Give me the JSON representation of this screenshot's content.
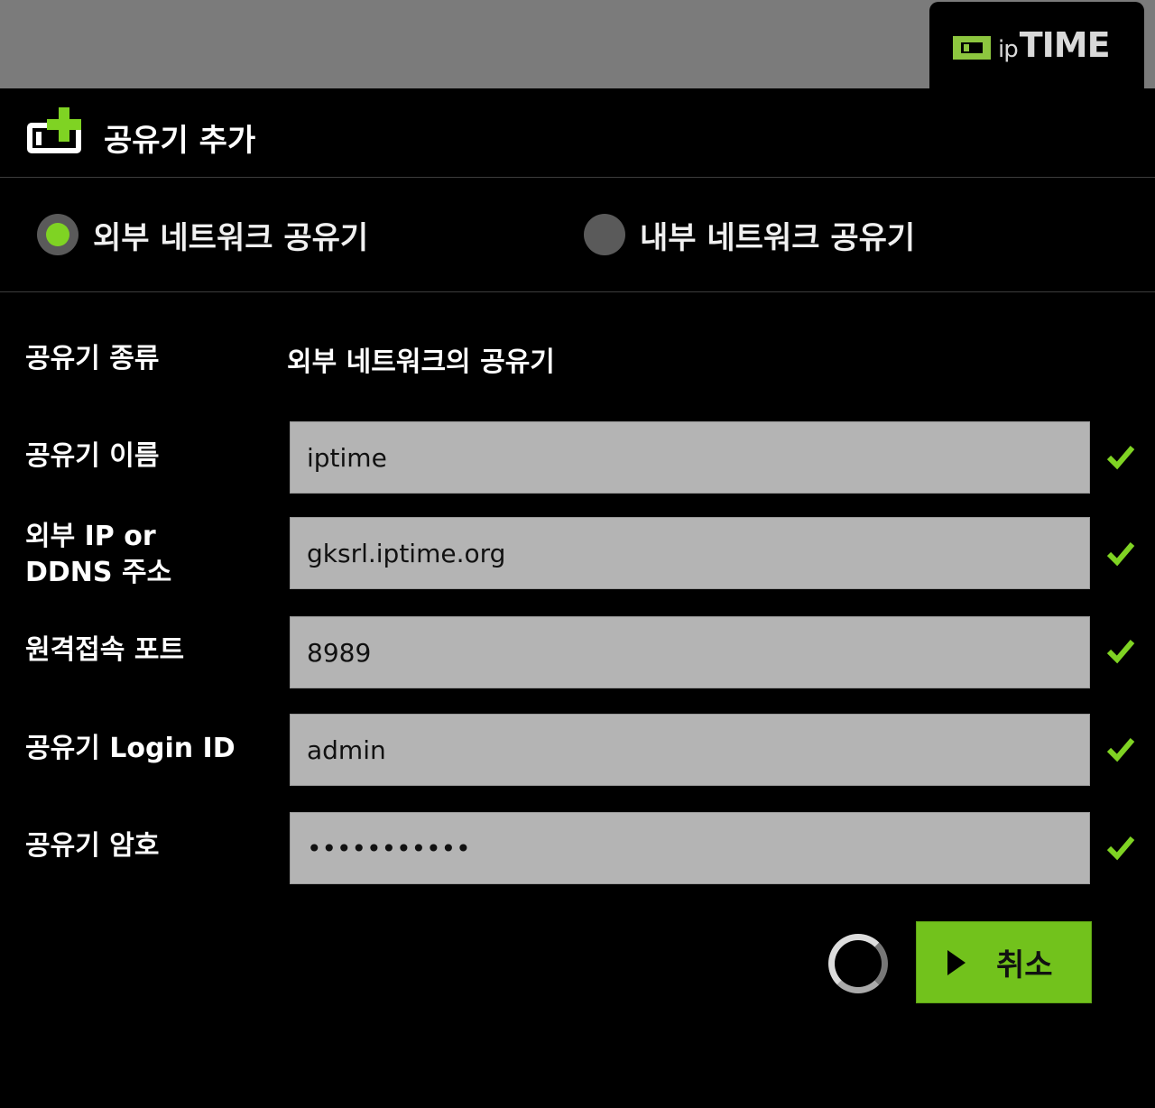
{
  "brand": {
    "logo_ip": "ip",
    "logo_time": "TIME",
    "accent_color": "#7fd323"
  },
  "header": {
    "title": "공유기 추가",
    "icon": "add-router-icon"
  },
  "network_type": {
    "options": [
      {
        "label": "외부 네트워크 공유기",
        "selected": true
      },
      {
        "label": "내부 네트워크 공유기",
        "selected": false
      }
    ]
  },
  "form": {
    "router_type": {
      "label": "공유기 종류",
      "value": "외부 네트워크의 공유기"
    },
    "router_name": {
      "label": "공유기 이름",
      "value": "iptime"
    },
    "address": {
      "label_line1": "외부 IP or",
      "label_line2": "DDNS 주소",
      "value": "gksrl.iptime.org"
    },
    "port": {
      "label": "원격접속 포트",
      "value": "8989"
    },
    "login_id": {
      "label": "공유기 Login ID",
      "value": "admin"
    },
    "password": {
      "label": "공유기 암호",
      "value": "•••••••••••"
    }
  },
  "actions": {
    "cancel_label": "취소"
  }
}
